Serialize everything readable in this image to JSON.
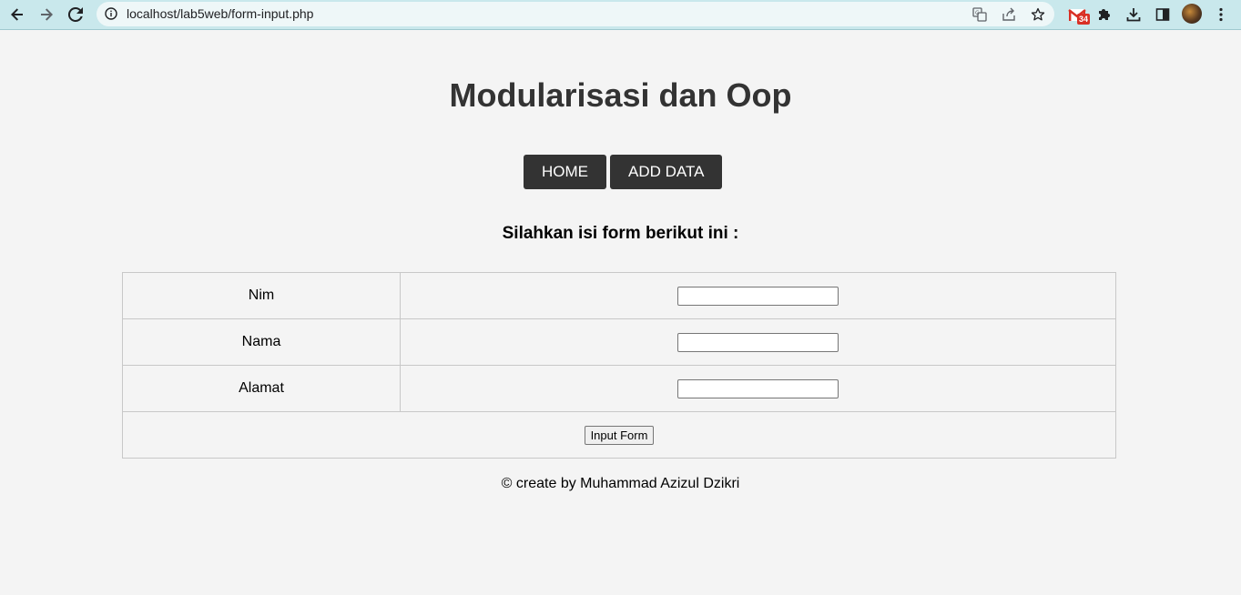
{
  "browser": {
    "url": "localhost/lab5web/form-input.php",
    "mail_badge_count": "34",
    "icons": {
      "back": "back-arrow-icon",
      "forward": "forward-arrow-icon",
      "reload": "reload-icon",
      "site_info": "info-icon",
      "translate": "translate-icon",
      "share": "share-icon",
      "bookmark": "star-icon",
      "gmail": "mail-icon",
      "extensions": "puzzle-icon",
      "downloads": "download-icon",
      "side_panel": "side-panel-icon",
      "menu": "kebab-menu-icon"
    }
  },
  "page": {
    "title": "Modularisasi dan Oop",
    "nav": [
      {
        "label": "HOME"
      },
      {
        "label": "ADD DATA"
      }
    ],
    "form_heading": "Silahkan isi form berikut ini :",
    "form": {
      "fields": [
        {
          "label": "Nim",
          "value": ""
        },
        {
          "label": "Nama",
          "value": ""
        },
        {
          "label": "Alamat",
          "value": ""
        }
      ],
      "submit_label": "Input Form"
    },
    "footer": "© create by Muhammad Azizul Dzikri"
  },
  "colors": {
    "chrome_bar": "#c9e8ec",
    "page_background": "#f4f4f4",
    "nav_button": "#333333",
    "title_text": "#333333"
  }
}
